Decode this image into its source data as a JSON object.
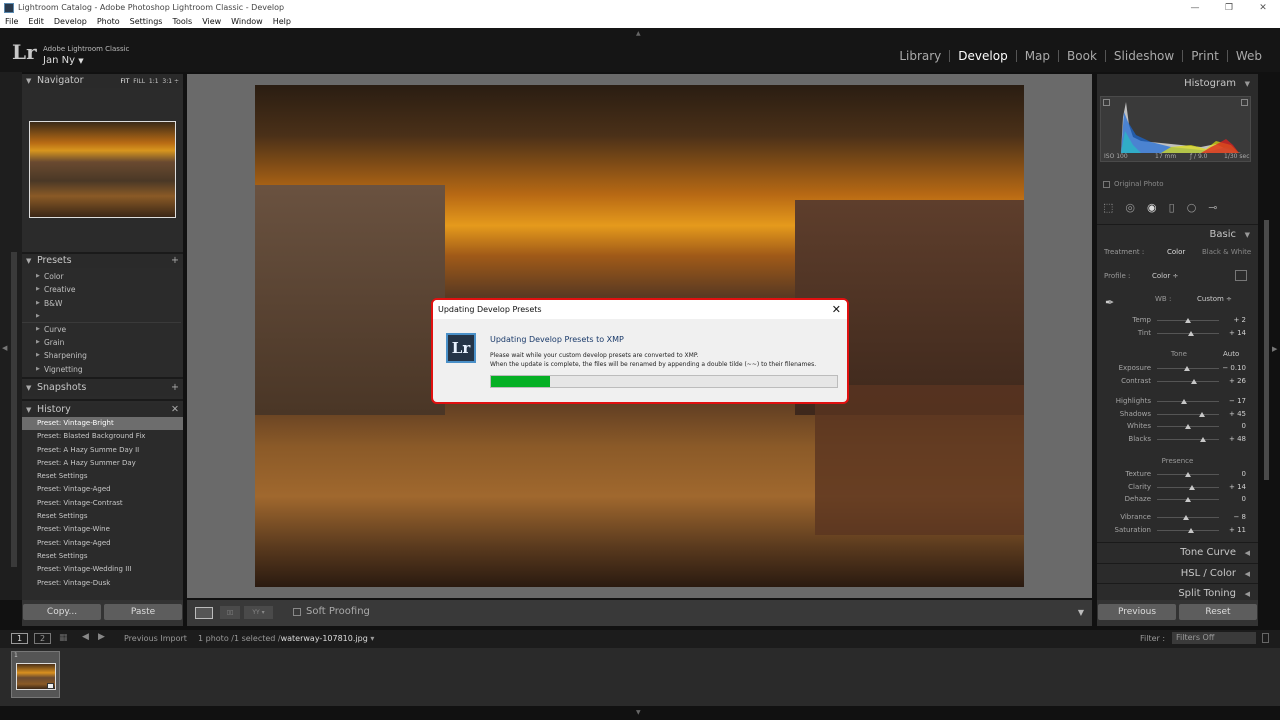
{
  "window": {
    "title": "Lightroom Catalog - Adobe Photoshop Lightroom Classic - Develop",
    "controls": [
      "—",
      "❐",
      "✕"
    ]
  },
  "menu": [
    "File",
    "Edit",
    "Develop",
    "Photo",
    "Settings",
    "Tools",
    "View",
    "Window",
    "Help"
  ],
  "identity": {
    "logo": "Lr",
    "app": "Adobe Lightroom Classic",
    "user": "Jan Ny"
  },
  "modules": [
    "Library",
    "Develop",
    "Map",
    "Book",
    "Slideshow",
    "Print",
    "Web"
  ],
  "active_module": "Develop",
  "navigator": {
    "title": "Navigator",
    "zoom": [
      "FIT",
      "FILL",
      "1:1",
      "3:1"
    ]
  },
  "presets": {
    "title": "Presets",
    "add": "+",
    "groups1": [
      "Color",
      "Creative",
      "B&W"
    ],
    "groups2": [
      "Curve",
      "Grain",
      "Sharpening",
      "Vignetting"
    ]
  },
  "snapshots": {
    "title": "Snapshots",
    "add": "+"
  },
  "history": {
    "title": "History",
    "clear": "✕",
    "items": [
      "Preset: Vintage-Bright",
      "Preset: Blasted Background Fix",
      "Preset: A Hazy Summe Day II",
      "Preset: A Hazy Summer Day",
      "Reset Settings",
      "Preset: Vintage-Aged",
      "Preset: Vintage-Contrast",
      "Reset Settings",
      "Preset: Vintage-Wine",
      "Preset: Vintage-Aged",
      "Reset Settings",
      "Preset: Vintage-Wedding III",
      "Preset: Vintage-Dusk"
    ]
  },
  "left_buttons": {
    "copy": "Copy...",
    "paste": "Paste"
  },
  "toolbar": {
    "soft_proofing": "Soft Proofing"
  },
  "histogram": {
    "title": "Histogram",
    "iso": "ISO 100",
    "focal": "17 mm",
    "aperture": "ƒ / 9.0",
    "shutter": "1/30 sec",
    "original": "Original Photo"
  },
  "basic": {
    "title": "Basic",
    "treatment_label": "Treatment :",
    "treatment_color": "Color",
    "treatment_bw": "Black & White",
    "profile_label": "Profile :",
    "profile_value": "Color ÷",
    "wb_label": "WB :",
    "wb_value": "Custom ÷",
    "tone_label": "Tone",
    "auto": "Auto",
    "presence_label": "Presence",
    "sliders1": [
      {
        "label": "Temp",
        "value": "+ 2",
        "pos": 0.5
      },
      {
        "label": "Tint",
        "value": "+ 14",
        "pos": 0.55
      }
    ],
    "sliders2": [
      {
        "label": "Exposure",
        "value": "− 0.10",
        "pos": 0.49
      },
      {
        "label": "Contrast",
        "value": "+ 26",
        "pos": 0.6
      }
    ],
    "sliders3": [
      {
        "label": "Highlights",
        "value": "− 17",
        "pos": 0.43
      },
      {
        "label": "Shadows",
        "value": "+ 45",
        "pos": 0.72
      },
      {
        "label": "Whites",
        "value": "0",
        "pos": 0.5
      },
      {
        "label": "Blacks",
        "value": "+ 48",
        "pos": 0.74
      }
    ],
    "sliders4": [
      {
        "label": "Texture",
        "value": "0",
        "pos": 0.5
      },
      {
        "label": "Clarity",
        "value": "+ 14",
        "pos": 0.57
      },
      {
        "label": "Dehaze",
        "value": "0",
        "pos": 0.5
      }
    ],
    "sliders5": [
      {
        "label": "Vibrance",
        "value": "− 8",
        "pos": 0.46
      },
      {
        "label": "Saturation",
        "value": "+ 11",
        "pos": 0.55
      }
    ]
  },
  "right_sections": [
    "Tone Curve",
    "HSL / Color",
    "Split Toning"
  ],
  "right_buttons": {
    "previous": "Previous",
    "reset": "Reset"
  },
  "filmstrip": {
    "views": [
      "1",
      "2"
    ],
    "source": "Previous Import",
    "count": "1 photo /1 selected /",
    "filename": "waterway-107810.jpg",
    "filter_label": "Filter :",
    "filter_value": "Filters Off",
    "thumb_index": "1"
  },
  "dialog": {
    "title": "Updating Develop Presets",
    "heading": "Updating Develop Presets to XMP",
    "line1": "Please wait while your custom develop presets are converted to XMP.",
    "line2": "When the update is complete, the files will be renamed by appending a double tilde (~~) to their filenames.",
    "progress": 0.17,
    "icon": "Lr",
    "close": "✕"
  },
  "colors": {
    "progress": "#06b025",
    "dialog_border": "#e01010",
    "panel": "#2b2b2b",
    "canvas": "#6a6a6a"
  }
}
